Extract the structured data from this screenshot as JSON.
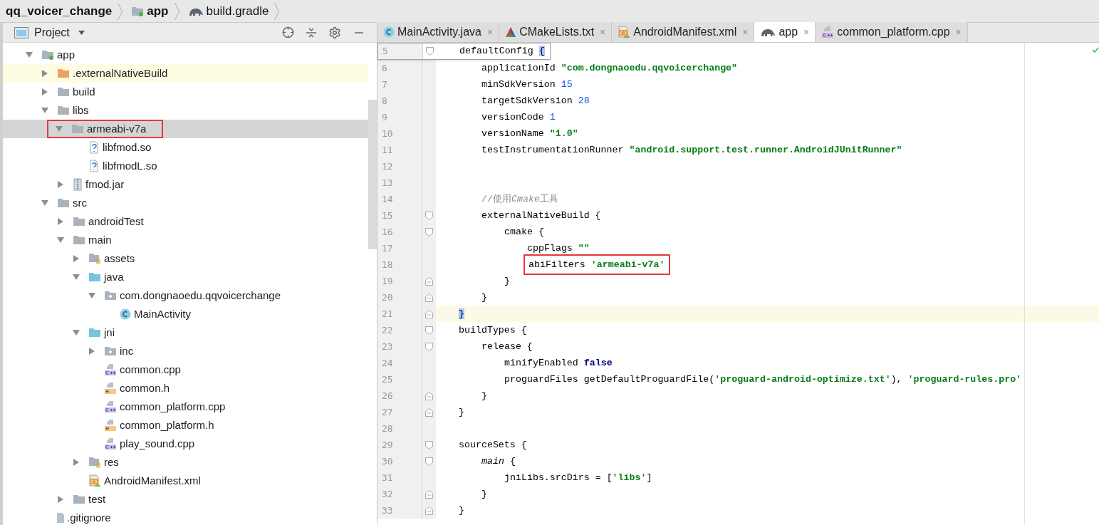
{
  "breadcrumbs": [
    {
      "label": "qq_voicer_change",
      "kind": "project"
    },
    {
      "label": "app",
      "kind": "module"
    },
    {
      "label": "build.gradle",
      "kind": "gradle"
    }
  ],
  "project_panel": {
    "title": "Project",
    "tree": [
      {
        "label": "app",
        "kind": "module",
        "expanded": true,
        "selected": false,
        "highlighted": false,
        "boxed": false,
        "children": [
          {
            "label": ".externalNativeBuild",
            "kind": "folder-orange",
            "expanded": false,
            "selected": false,
            "highlighted": true,
            "boxed": false
          },
          {
            "label": "build",
            "kind": "folder",
            "expanded": false,
            "selected": false,
            "highlighted": false,
            "boxed": false
          },
          {
            "label": "libs",
            "kind": "folder",
            "expanded": true,
            "selected": false,
            "highlighted": false,
            "boxed": false,
            "children": [
              {
                "label": "armeabi-v7a",
                "kind": "folder",
                "expanded": true,
                "selected": true,
                "highlighted": false,
                "boxed": true,
                "children": [
                  {
                    "label": "libfmod.so",
                    "kind": "unknown",
                    "selected": false,
                    "highlighted": false,
                    "boxed": false
                  },
                  {
                    "label": "libfmodL.so",
                    "kind": "unknown",
                    "selected": false,
                    "highlighted": false,
                    "boxed": false
                  }
                ]
              },
              {
                "label": "fmod.jar",
                "kind": "jar",
                "expanded": false,
                "selected": false,
                "highlighted": false,
                "boxed": false
              }
            ]
          },
          {
            "label": "src",
            "kind": "folder",
            "expanded": true,
            "selected": false,
            "highlighted": false,
            "boxed": false,
            "children": [
              {
                "label": "androidTest",
                "kind": "folder",
                "expanded": false,
                "selected": false,
                "highlighted": false,
                "boxed": false
              },
              {
                "label": "main",
                "kind": "folder",
                "expanded": true,
                "selected": false,
                "highlighted": false,
                "boxed": false,
                "children": [
                  {
                    "label": "assets",
                    "kind": "res",
                    "expanded": false,
                    "selected": false,
                    "highlighted": false,
                    "boxed": false
                  },
                  {
                    "label": "java",
                    "kind": "folder-blue",
                    "expanded": true,
                    "selected": false,
                    "highlighted": false,
                    "boxed": false,
                    "children": [
                      {
                        "label": "com.dongnaoedu.qqvoicerchange",
                        "kind": "package",
                        "expanded": true,
                        "selected": false,
                        "highlighted": false,
                        "boxed": false,
                        "children": [
                          {
                            "label": "MainActivity",
                            "kind": "class",
                            "selected": false,
                            "highlighted": false,
                            "boxed": false
                          }
                        ]
                      }
                    ]
                  },
                  {
                    "label": "jni",
                    "kind": "folder-blue",
                    "expanded": true,
                    "selected": false,
                    "highlighted": false,
                    "boxed": false,
                    "children": [
                      {
                        "label": "inc",
                        "kind": "package",
                        "expanded": false,
                        "selected": false,
                        "highlighted": false,
                        "boxed": false
                      },
                      {
                        "label": "common.cpp",
                        "kind": "cpp",
                        "selected": false,
                        "highlighted": false,
                        "boxed": false
                      },
                      {
                        "label": "common.h",
                        "kind": "h",
                        "selected": false,
                        "highlighted": false,
                        "boxed": false
                      },
                      {
                        "label": "common_platform.cpp",
                        "kind": "cpp",
                        "selected": false,
                        "highlighted": false,
                        "boxed": false
                      },
                      {
                        "label": "common_platform.h",
                        "kind": "h",
                        "selected": false,
                        "highlighted": false,
                        "boxed": false
                      },
                      {
                        "label": "play_sound.cpp",
                        "kind": "cpp",
                        "selected": false,
                        "highlighted": false,
                        "boxed": false
                      }
                    ]
                  },
                  {
                    "label": "res",
                    "kind": "res",
                    "expanded": false,
                    "selected": false,
                    "highlighted": false,
                    "boxed": false
                  },
                  {
                    "label": "AndroidManifest.xml",
                    "kind": "manifest",
                    "selected": false,
                    "highlighted": false,
                    "boxed": false
                  }
                ]
              },
              {
                "label": "test",
                "kind": "folder",
                "expanded": false,
                "selected": false,
                "highlighted": false,
                "boxed": false
              }
            ]
          },
          {
            "label": ".gitignore",
            "kind": "text",
            "selected": false,
            "highlighted": false,
            "boxed": false
          }
        ]
      }
    ]
  },
  "tabs": [
    {
      "label": "MainActivity.java",
      "kind": "class",
      "selected": false,
      "close": "×"
    },
    {
      "label": "CMakeLists.txt",
      "kind": "cmake",
      "selected": false,
      "close": "×"
    },
    {
      "label": "AndroidManifest.xml",
      "kind": "manifest",
      "selected": false,
      "close": "×"
    },
    {
      "label": "app",
      "kind": "gradle",
      "selected": true,
      "close": "×"
    },
    {
      "label": "common_platform.cpp",
      "kind": "cpp",
      "selected": false,
      "close": "×"
    }
  ],
  "editor": {
    "lines": [
      {
        "number": "5",
        "fold_start": true,
        "fold_end": false,
        "current": false,
        "sticky": true,
        "boxed": false,
        "tokens": [
          {
            "kind": "plain",
            "text": "defaultConfig "
          },
          {
            "kind": "brace",
            "text": "{"
          }
        ],
        "children": [
          {
            "number": "6",
            "fold_start": false,
            "fold_end": false,
            "current": false,
            "sticky": false,
            "boxed": false,
            "tokens": [
              {
                "kind": "plain",
                "text": "applicationId "
              },
              {
                "kind": "string",
                "text": "\"com.dongnaoedu.qqvoicerchange\""
              }
            ]
          },
          {
            "number": "7",
            "fold_start": false,
            "fold_end": false,
            "current": false,
            "sticky": false,
            "boxed": false,
            "tokens": [
              {
                "kind": "plain",
                "text": "minSdkVersion "
              },
              {
                "kind": "number",
                "text": "15"
              }
            ]
          },
          {
            "number": "8",
            "fold_start": false,
            "fold_end": false,
            "current": false,
            "sticky": false,
            "boxed": false,
            "tokens": [
              {
                "kind": "plain",
                "text": "targetSdkVersion "
              },
              {
                "kind": "number",
                "text": "28"
              }
            ]
          },
          {
            "number": "9",
            "fold_start": false,
            "fold_end": false,
            "current": false,
            "sticky": false,
            "boxed": false,
            "tokens": [
              {
                "kind": "plain",
                "text": "versionCode "
              },
              {
                "kind": "number",
                "text": "1"
              }
            ]
          },
          {
            "number": "10",
            "fold_start": false,
            "fold_end": false,
            "current": false,
            "sticky": false,
            "boxed": false,
            "tokens": [
              {
                "kind": "plain",
                "text": "versionName "
              },
              {
                "kind": "string",
                "text": "\"1.0\""
              }
            ]
          },
          {
            "number": "11",
            "fold_start": false,
            "fold_end": false,
            "current": false,
            "sticky": false,
            "boxed": false,
            "tokens": [
              {
                "kind": "plain",
                "text": "testInstrumentationRunner "
              },
              {
                "kind": "string",
                "text": "\"android.support.test.runner.AndroidJUnitRunner\""
              }
            ]
          },
          {
            "number": "12",
            "fold_start": false,
            "fold_end": false,
            "current": false,
            "sticky": false,
            "boxed": false
          },
          {
            "number": "13",
            "fold_start": false,
            "fold_end": false,
            "current": false,
            "sticky": false,
            "boxed": false
          },
          {
            "number": "14",
            "fold_start": false,
            "fold_end": false,
            "current": false,
            "sticky": false,
            "boxed": false,
            "tokens": [
              {
                "kind": "comment",
                "text": "//使用"
              },
              {
                "kind": "comment-italic",
                "text": "Cmake"
              },
              {
                "kind": "comment",
                "text": "工具"
              }
            ]
          },
          {
            "number": "15",
            "fold_start": true,
            "fold_end": false,
            "current": false,
            "sticky": false,
            "boxed": false,
            "tokens": [
              {
                "kind": "plain",
                "text": "externalNativeBuild {"
              }
            ],
            "children": [
              {
                "number": "16",
                "fold_start": true,
                "fold_end": false,
                "current": false,
                "sticky": false,
                "boxed": false,
                "tokens": [
                  {
                    "kind": "plain",
                    "text": "cmake {"
                  }
                ],
                "children": [
                  {
                    "number": "17",
                    "fold_start": false,
                    "fold_end": false,
                    "current": false,
                    "sticky": false,
                    "boxed": false,
                    "tokens": [
                      {
                        "kind": "plain",
                        "text": "cppFlags "
                      },
                      {
                        "kind": "string",
                        "text": "\"\""
                      }
                    ]
                  },
                  {
                    "number": "18",
                    "fold_start": false,
                    "fold_end": false,
                    "current": false,
                    "sticky": false,
                    "boxed": true,
                    "tokens": [
                      {
                        "kind": "plain",
                        "text": "abiFilters "
                      },
                      {
                        "kind": "string",
                        "text": "'armeabi-v7a'"
                      }
                    ]
                  }
                ]
              },
              {
                "number": "19",
                "fold_start": false,
                "fold_end": true,
                "current": false,
                "sticky": false,
                "boxed": false,
                "tokens": [
                  {
                    "kind": "plain",
                    "text": "}"
                  }
                ]
              }
            ]
          },
          {
            "number": "20",
            "fold_start": false,
            "fold_end": true,
            "current": false,
            "sticky": false,
            "boxed": false,
            "tokens": [
              {
                "kind": "plain",
                "text": "}"
              }
            ]
          }
        ]
      },
      {
        "number": "21",
        "fold_start": false,
        "fold_end": true,
        "current": true,
        "sticky": false,
        "boxed": false,
        "tokens": [
          {
            "kind": "brace",
            "text": "}"
          }
        ]
      },
      {
        "number": "22",
        "fold_start": true,
        "fold_end": false,
        "current": false,
        "sticky": false,
        "boxed": false,
        "tokens": [
          {
            "kind": "plain",
            "text": "buildTypes {"
          }
        ],
        "children": [
          {
            "number": "23",
            "fold_start": true,
            "fold_end": false,
            "current": false,
            "sticky": false,
            "boxed": false,
            "tokens": [
              {
                "kind": "plain",
                "text": "release {"
              }
            ],
            "children": [
              {
                "number": "24",
                "fold_start": false,
                "fold_end": false,
                "current": false,
                "sticky": false,
                "boxed": false,
                "tokens": [
                  {
                    "kind": "plain",
                    "text": "minifyEnabled "
                  },
                  {
                    "kind": "keyword",
                    "text": "false"
                  }
                ]
              },
              {
                "number": "25",
                "fold_start": false,
                "fold_end": false,
                "current": false,
                "sticky": false,
                "boxed": false,
                "tokens": [
                  {
                    "kind": "plain",
                    "text": "proguardFiles getDefaultProguardFile("
                  },
                  {
                    "kind": "string",
                    "text": "'proguard-android-optimize.txt'"
                  },
                  {
                    "kind": "plain",
                    "text": "), "
                  },
                  {
                    "kind": "string",
                    "text": "'proguard-rules.pro'"
                  }
                ]
              }
            ]
          },
          {
            "number": "26",
            "fold_start": false,
            "fold_end": true,
            "current": false,
            "sticky": false,
            "boxed": false,
            "tokens": [
              {
                "kind": "plain",
                "text": "}"
              }
            ]
          }
        ]
      },
      {
        "number": "27",
        "fold_start": false,
        "fold_end": true,
        "current": false,
        "sticky": false,
        "boxed": false,
        "tokens": [
          {
            "kind": "plain",
            "text": "}"
          }
        ]
      },
      {
        "number": "28",
        "fold_start": false,
        "fold_end": false,
        "current": false,
        "sticky": false,
        "boxed": false
      },
      {
        "number": "29",
        "fold_start": true,
        "fold_end": false,
        "current": false,
        "sticky": false,
        "boxed": false,
        "tokens": [
          {
            "kind": "plain",
            "text": "sourceSets {"
          }
        ],
        "children": [
          {
            "number": "30",
            "fold_start": true,
            "fold_end": false,
            "current": false,
            "sticky": false,
            "boxed": false,
            "tokens": [
              {
                "kind": "italic",
                "text": "main"
              },
              {
                "kind": "plain",
                "text": " {"
              }
            ],
            "children": [
              {
                "number": "31",
                "fold_start": false,
                "fold_end": false,
                "current": false,
                "sticky": false,
                "boxed": false,
                "tokens": [
                  {
                    "kind": "plain",
                    "text": "jniLibs.srcDirs = ["
                  },
                  {
                    "kind": "string",
                    "text": "'libs'"
                  },
                  {
                    "kind": "plain",
                    "text": "]"
                  }
                ]
              }
            ]
          },
          {
            "number": "32",
            "fold_start": false,
            "fold_end": true,
            "current": false,
            "sticky": false,
            "boxed": false,
            "tokens": [
              {
                "kind": "plain",
                "text": "}"
              }
            ]
          }
        ]
      },
      {
        "number": "33",
        "fold_start": false,
        "fold_end": true,
        "current": false,
        "sticky": false,
        "boxed": false,
        "tokens": [
          {
            "kind": "plain",
            "text": "}"
          }
        ]
      }
    ]
  }
}
